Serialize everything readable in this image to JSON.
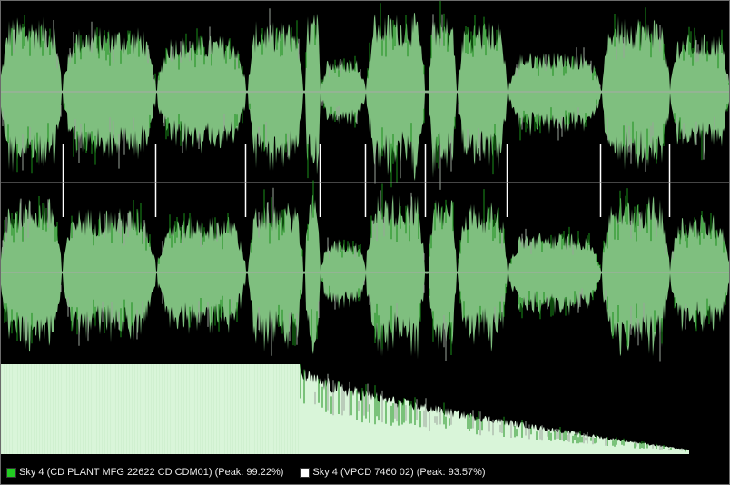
{
  "colors": {
    "background": "#000000",
    "waveform_fill": "#7fbf7f",
    "waveform_peak": "#1a8f1a",
    "waveform_secondary": "#9aa39a",
    "spectrum_fill": "#d9f5d9",
    "axis_line": "#a8a8a8",
    "track_marker": "#ffffff"
  },
  "chart_data": {
    "type": "area",
    "legend_placement": "bottom",
    "grid": false,
    "series": [
      {
        "name": "Sky 4 (CD PLANT MFG  22622 CD CDM01) (Peak: 99.22%)",
        "color": "#22cc22"
      },
      {
        "name": "Sky 4 (VPCD 7460 02) (Peak: 93.57%)",
        "color": "#ffffff"
      }
    ],
    "segments": [
      {
        "start": 0.0,
        "end": 0.083,
        "amp": 0.9
      },
      {
        "start": 0.085,
        "end": 0.212,
        "amp": 0.78
      },
      {
        "start": 0.215,
        "end": 0.336,
        "amp": 0.68
      },
      {
        "start": 0.34,
        "end": 0.415,
        "amp": 0.85
      },
      {
        "start": 0.418,
        "end": 0.438,
        "amp": 0.95
      },
      {
        "start": 0.44,
        "end": 0.5,
        "amp": 0.4
      },
      {
        "start": 0.502,
        "end": 0.582,
        "amp": 0.95
      },
      {
        "start": 0.588,
        "end": 0.625,
        "amp": 0.92
      },
      {
        "start": 0.628,
        "end": 0.695,
        "amp": 0.85
      },
      {
        "start": 0.698,
        "end": 0.823,
        "amp": 0.48
      },
      {
        "start": 0.826,
        "end": 0.918,
        "amp": 0.92
      },
      {
        "start": 0.92,
        "end": 1.0,
        "amp": 0.7
      }
    ],
    "track_markers": [
      0.085,
      0.212,
      0.336,
      0.438,
      0.5,
      0.582,
      0.695,
      0.823,
      0.918
    ]
  }
}
